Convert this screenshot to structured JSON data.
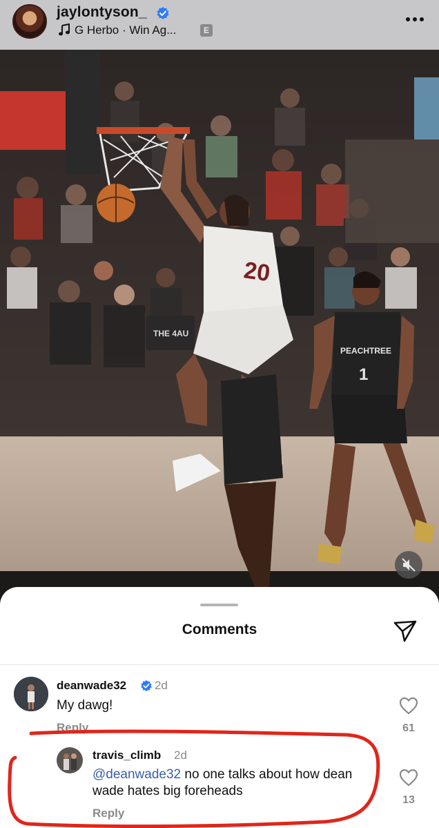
{
  "header": {
    "username": "jaylontyson_",
    "song": "G Herbo · Win Ag...",
    "explicit_badge": "E"
  },
  "photo": {
    "jersey_left": "20",
    "jersey_right_team": "PEACHTREE",
    "jersey_right_number": "1",
    "banner_text": "THE 4AU"
  },
  "comments_sheet": {
    "title": "Comments",
    "comments": [
      {
        "username": "deanwade32",
        "verified": true,
        "time": "2d",
        "text": "My dawg!",
        "reply_label": "Reply",
        "likes": "61"
      },
      {
        "username": "travis_climb",
        "time": "2d",
        "mention": "@deanwade32",
        "text": " no one talks about how dean wade hates big foreheads",
        "reply_label": "Reply",
        "likes": "13"
      }
    ]
  },
  "colors": {
    "verified_blue": "#2d7cf6",
    "annotation_red": "#e0261b",
    "mention_blue": "#3a5fa8"
  },
  "icons": [
    "verified-icon",
    "music-note-icon",
    "more-icon",
    "mute-icon",
    "share-send-icon",
    "heart-icon"
  ]
}
